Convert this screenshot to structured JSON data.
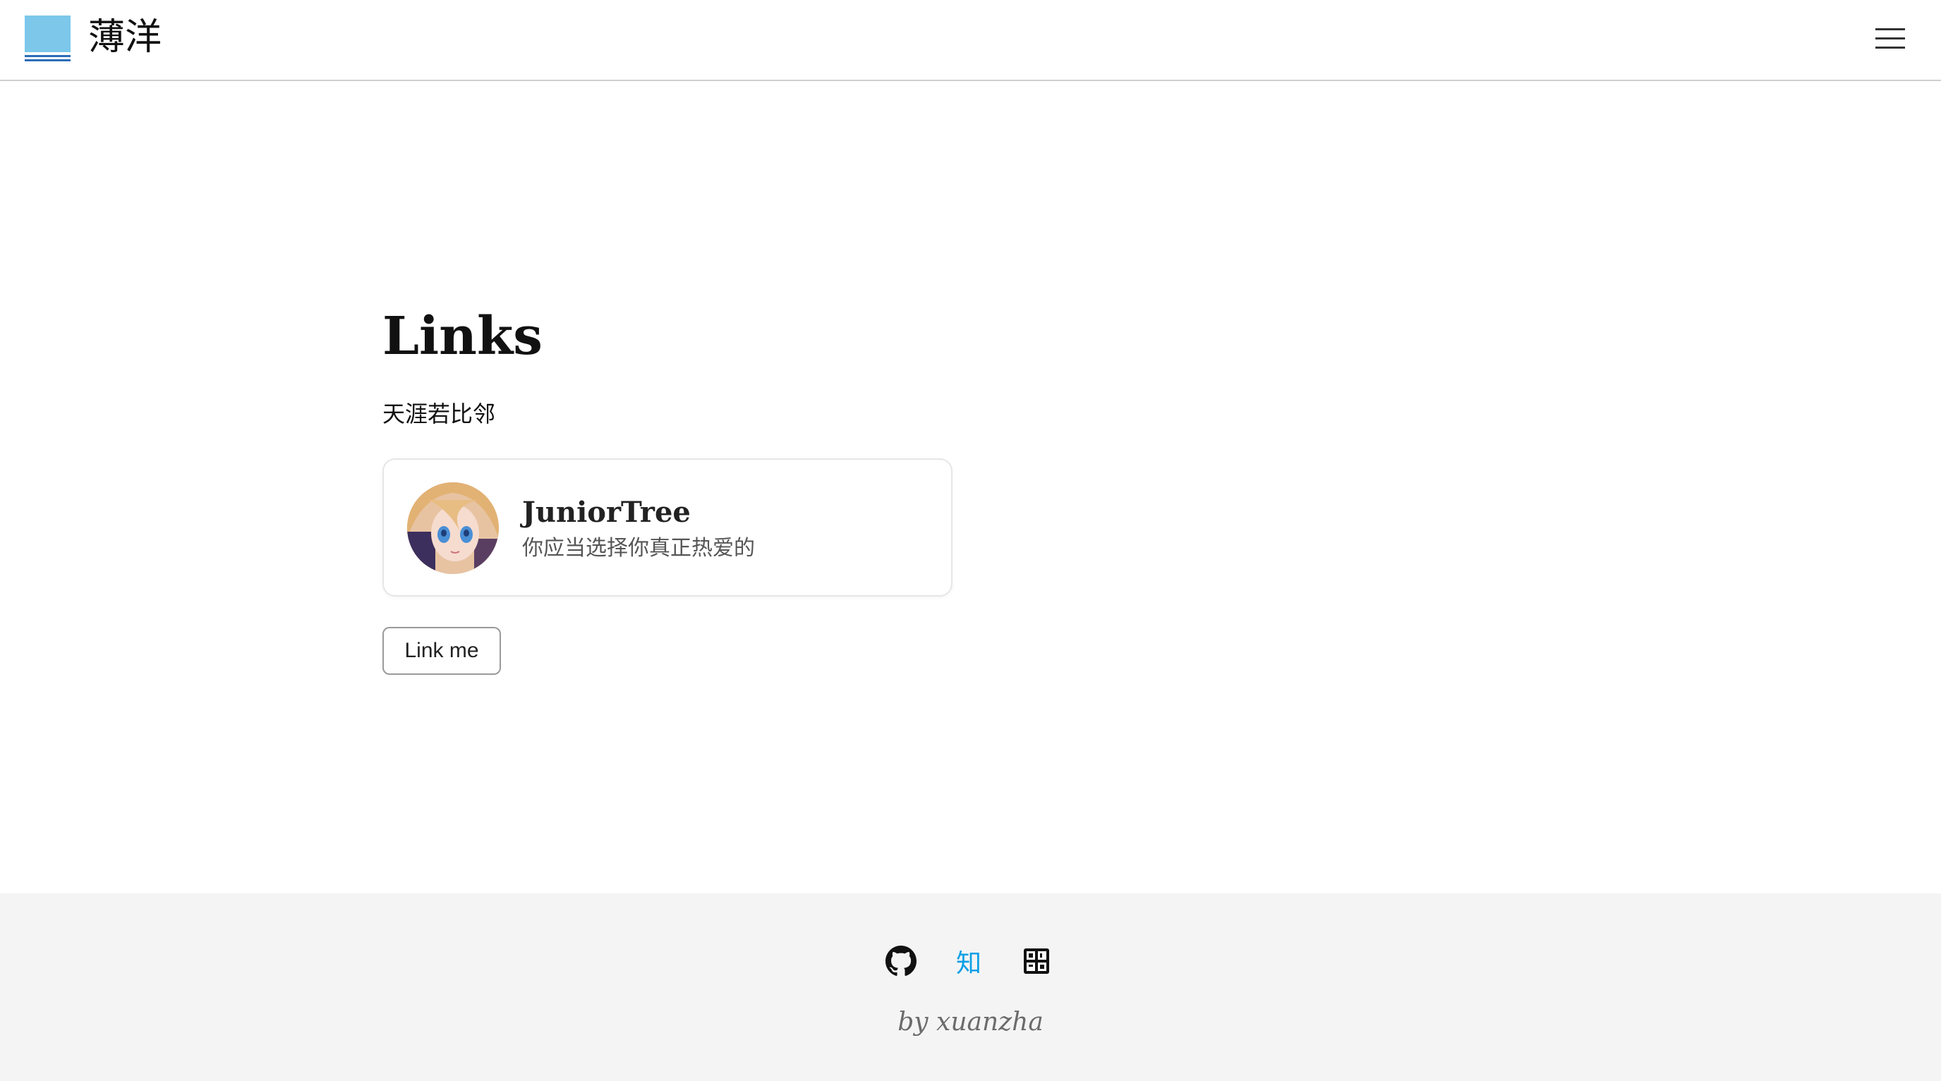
{
  "header": {
    "site_title": "薄洋",
    "logo_icon": "logo-icon",
    "menu_icon": "hamburger-menu-icon"
  },
  "main": {
    "title": "Links",
    "subtitle": "天涯若比邻",
    "card": {
      "name": "JuniorTree",
      "description": "你应当选择你真正热爱的",
      "avatar_icon": "avatar"
    },
    "button_label": "Link me"
  },
  "footer": {
    "social_icons": [
      "github-icon",
      "zhihu-icon",
      "other-icon"
    ],
    "zhihu_label": "知",
    "credit": "by xuanzha"
  },
  "colors": {
    "logo_blue": "#7cc7ea",
    "logo_line": "#2b6cb8",
    "zhihu_blue": "#0a9fe6",
    "footer_bg": "#f4f4f4"
  }
}
